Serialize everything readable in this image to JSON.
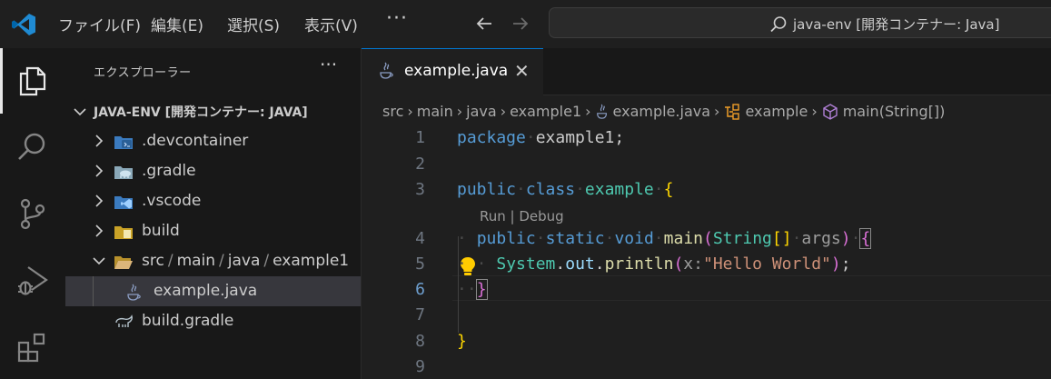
{
  "menu": [
    "ファイル(F)",
    "編集(E)",
    "選択(S)",
    "表示(V)"
  ],
  "command_center": "java-env [開発コンテナー: Java]",
  "sidebar": {
    "title": "エクスプローラー",
    "more": "···",
    "workspace": "JAVA-ENV [開発コンテナー: JAVA]",
    "items": [
      {
        "label": ".devcontainer",
        "icon": "devcontainer-folder-icon"
      },
      {
        "label": ".gradle",
        "icon": "gradle-folder-icon"
      },
      {
        "label": ".vscode",
        "icon": "vscode-folder-icon"
      },
      {
        "label": "build",
        "icon": "build-folder-icon"
      },
      {
        "path": [
          "src",
          "main",
          "java",
          "example1"
        ],
        "icon": "open-folder-icon"
      },
      {
        "label": "example.java",
        "icon": "java-file-icon"
      },
      {
        "label": "build.gradle",
        "icon": "gradle-file-icon"
      }
    ]
  },
  "tab": {
    "label": "example.java",
    "close": "✕"
  },
  "breadcrumbs": [
    "src",
    "main",
    "java",
    "example1",
    "example.java",
    "example",
    "main(String[])"
  ],
  "code": {
    "line_numbers": [
      "1",
      "2",
      "3",
      "4",
      "5",
      "6",
      "7",
      "8",
      "9"
    ],
    "codelens": "Run | Debug",
    "tokens": {
      "package": "package",
      "pkg_name": "example1",
      "public": "public",
      "class": "class",
      "class_name": "example",
      "static": "static",
      "void": "void",
      "main": "main",
      "string_type": "String",
      "args": "args",
      "system": "System",
      "out": "out",
      "println": "println",
      "param_hint": "x:",
      "hello": "\"Hello World\""
    }
  }
}
